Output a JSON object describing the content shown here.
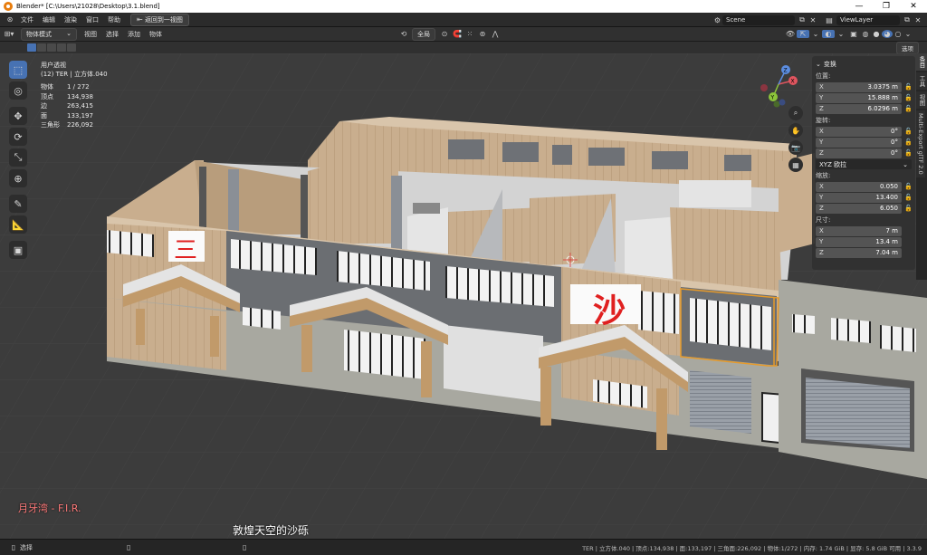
{
  "window": {
    "title": "Blender* [C:\\Users\\21028\\Desktop\\3.1.blend]"
  },
  "menu": {
    "items": [
      "文件",
      "编辑",
      "渲染",
      "窗口",
      "帮助"
    ],
    "back_button": "返回到一视图",
    "scene_name": "Scene",
    "view_layer": "ViewLayer"
  },
  "header": {
    "mode": "物体模式",
    "items": [
      "视图",
      "选择",
      "添加",
      "物体"
    ],
    "transform_orientation": "全局",
    "options": "选项"
  },
  "overlay_info": {
    "view_name": "用户透视",
    "collection": "(12) TER | 立方体.040",
    "stats": [
      {
        "label": "物体",
        "value": "1 / 272"
      },
      {
        "label": "顶点",
        "value": "134,938"
      },
      {
        "label": "边",
        "value": "263,415"
      },
      {
        "label": "面",
        "value": "133,197"
      },
      {
        "label": "三角形",
        "value": "226,092"
      }
    ]
  },
  "gizmo": {
    "axes": [
      "X",
      "Y",
      "Z"
    ]
  },
  "npanel": {
    "section": "变换",
    "location_label": "位置:",
    "location": [
      {
        "axis": "X",
        "value": "3.0375 m"
      },
      {
        "axis": "Y",
        "value": "15.888 m"
      },
      {
        "axis": "Z",
        "value": "6.0296 m"
      }
    ],
    "rotation_label": "旋转:",
    "rotation": [
      {
        "axis": "X",
        "value": "0°"
      },
      {
        "axis": "Y",
        "value": "0°"
      },
      {
        "axis": "Z",
        "value": "0°"
      }
    ],
    "rotation_mode": "XYZ 欧拉",
    "scale_label": "缩放:",
    "scale": [
      {
        "axis": "X",
        "value": "0.050"
      },
      {
        "axis": "Y",
        "value": "13.400"
      },
      {
        "axis": "Z",
        "value": "6.050"
      }
    ],
    "dimensions_label": "尺寸:",
    "dimensions": [
      {
        "axis": "X",
        "value": "7 m"
      },
      {
        "axis": "Y",
        "value": "13.4 m"
      },
      {
        "axis": "Z",
        "value": "7.04 m"
      }
    ]
  },
  "side_tabs": [
    "条目",
    "工具",
    "视图",
    "Multi-Export glTF 2.0"
  ],
  "scene_text": {
    "sign1": "三",
    "sign2": "沙"
  },
  "watermark": {
    "left": "月牙湾 - F.I.R.",
    "subtitle": "敦煌天空的沙砾"
  },
  "status": {
    "left": "选择",
    "right": "TER | 立方体.040 | 顶点:134,938 | 面:133,197 | 三角面:226,092 | 物体:1/272 | 内存: 1.74 GiB | 显存: 5.8 GiB 可用 | 3.3.9"
  },
  "colors": {
    "accent": "#4772b3",
    "orange_select": "#e69a2a",
    "sign_red": "#e02020"
  }
}
